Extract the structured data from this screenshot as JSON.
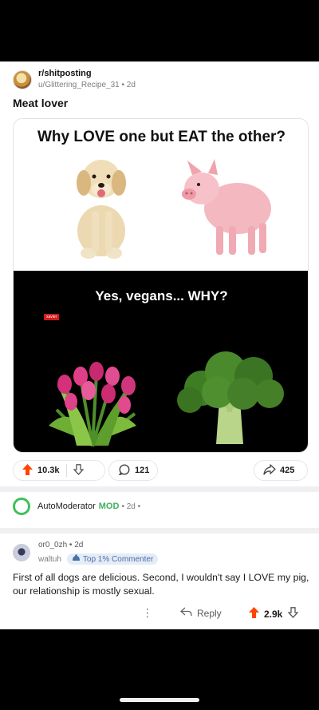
{
  "post": {
    "subreddit": "r/shitposting",
    "author": "u/Glittering_Recipe_31",
    "age": "2d",
    "title": "Meat lover"
  },
  "meme": {
    "top_text": "Why LOVE one but EAT the other?",
    "bottom_text": "Yes, vegans... WHY?",
    "tag": "xavier"
  },
  "actions": {
    "upvotes": "10.3k",
    "comments": "121",
    "shares": "425"
  },
  "automod": {
    "name": "AutoModerator",
    "badge": "MOD",
    "age": "2d"
  },
  "comment": {
    "username": "or0_0zh",
    "age": "2d",
    "secondary_name": "waltuh",
    "flair": "Top 1% Commenter",
    "body": "First of all dogs are delicious. Second, I wouldn't say I LOVE my pig, our relationship is mostly sexual.",
    "reply_label": "Reply",
    "votes": "2.9k"
  },
  "colors": {
    "upvote": "#ff4500",
    "mod_green": "#3fb15c",
    "flair_bg": "#e4ecf7"
  }
}
